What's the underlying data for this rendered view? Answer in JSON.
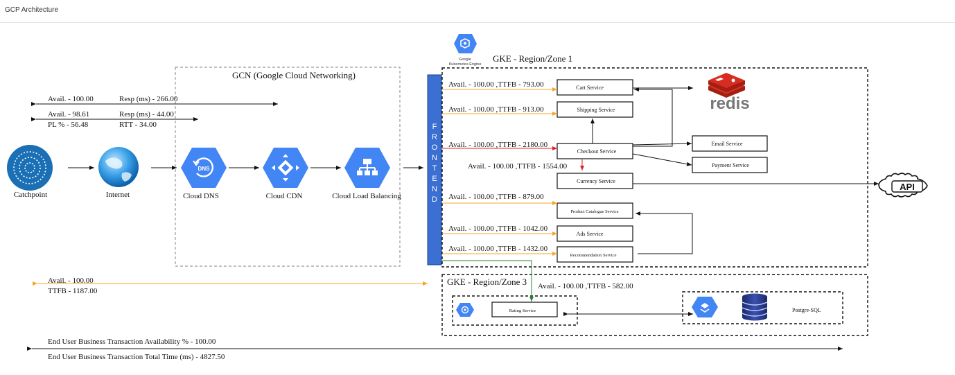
{
  "page": {
    "title": "GCP Architecture"
  },
  "gcn": {
    "title": "GCN (Google Cloud Networking)"
  },
  "gke1": {
    "title": "GKE - Region/Zone 1",
    "icon_caption_1": "Google",
    "icon_caption_2": "Kubernetes Engine"
  },
  "gke3": {
    "title": "GKE - Region/Zone 3"
  },
  "frontend": {
    "letters": [
      "F",
      "R",
      "O",
      "N",
      "T",
      "E",
      "N",
      "D"
    ]
  },
  "nodes": {
    "catchpoint": "Catchpoint",
    "internet": "Internet",
    "cloud_dns": "Cloud DNS",
    "dns_badge": "DNS",
    "cloud_cdn": "Cloud CDN",
    "cloud_lb": "Cloud Load Balancing",
    "redis": "redis",
    "api": "API",
    "postgres": "Postgre-SQL"
  },
  "services": {
    "cart": "Cart Service",
    "shipping": "Shipping Service",
    "checkout": "Checkout Service",
    "currency": "Currency Service",
    "product_catalogue": "Product Catalogue Service",
    "ads": "Ads Service",
    "recommendation": "Recommendation Service",
    "email": "Email Service",
    "payment": "Payment Service",
    "rating": "Rating Service"
  },
  "metrics": {
    "m1_avail": "Avail. - 100.00",
    "m1_resp": "Resp (ms) - 266.00",
    "m2_avail": "Avail. - 98.61",
    "m2_resp": "Resp (ms) - 44.00",
    "m2_pl": "PL % - 56.48",
    "m2_rtt": "RTT - 34.00",
    "cart": "Avail. - 100.00  ,TTFB - 793.00",
    "shipping": "Avail. - 100.00  ,TTFB - 913.00",
    "checkout": "Avail. - 100.00  ,TTFB - 2180.00",
    "currency": "Avail. - 100.00 ,TTFB - 1554.00",
    "product": "Avail. - 100.00  ,TTFB - 879.00",
    "ads": "Avail. - 100.00  ,TTFB - 1042.00",
    "recommendation": "Avail. - 100.00  ,TTFB - 1432.00",
    "rating": "Avail. - 100.00   ,TTFB - 582.00",
    "orange_avail": "Avail. - 100.00",
    "orange_ttfb": "TTFB - 1187.00",
    "end_avail": "End User Business Transaction Availability % - 100.00",
    "end_time": "End User Business Transaction Total Time (ms) - 4827.50"
  },
  "colors": {
    "gcp_blue": "#4285f4",
    "frontend_blue": "#3b6fd1",
    "redis_red": "#d82c20",
    "orange": "#f5a623",
    "red": "#e02020",
    "green": "#2a8a2a",
    "catchpoint": "#1a6fb5"
  }
}
